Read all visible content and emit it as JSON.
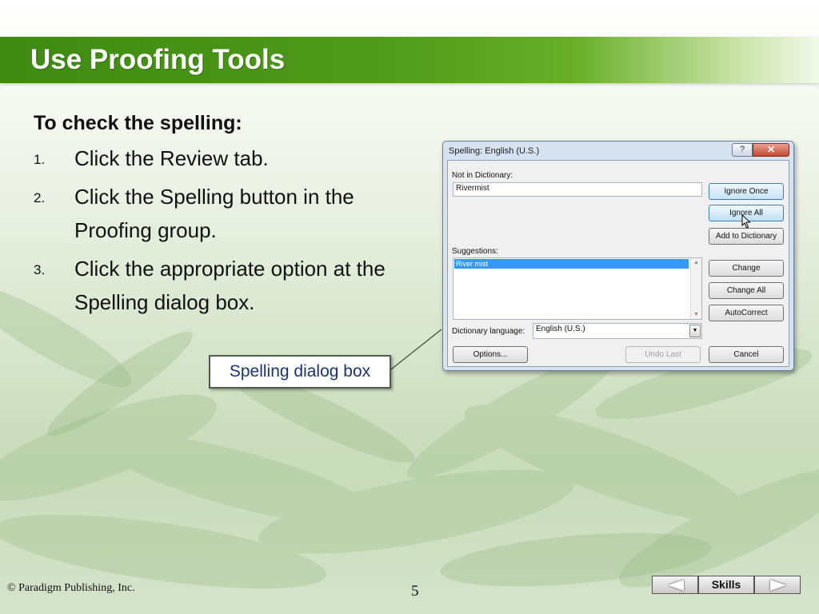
{
  "slide": {
    "title": "Use Proofing Tools",
    "heading": "To check the spelling:",
    "steps": [
      {
        "num": "1.",
        "text": "Click the Review tab."
      },
      {
        "num": "2.",
        "text": "Click the Spelling button in the Proofing group."
      },
      {
        "num": "3.",
        "text": "Click the appropriate option at the Spelling dialog box."
      }
    ],
    "callout": "Spelling dialog box"
  },
  "dialog": {
    "title": "Spelling: English (U.S.)",
    "help_glyph": "?",
    "close_glyph": "✕",
    "not_in_dictionary_label": "Not in Dictionary:",
    "not_in_dictionary_value": "Rivermist",
    "suggestions_label": "Suggestions:",
    "suggestions": [
      "River mist"
    ],
    "dictionary_language_label": "Dictionary language:",
    "dictionary_language_value": "English (U.S.)",
    "buttons": {
      "ignore_once": "Ignore Once",
      "ignore_all": "Ignore All",
      "add_to_dictionary": "Add to Dictionary",
      "change": "Change",
      "change_all": "Change All",
      "autocorrect": "AutoCorrect",
      "options": "Options...",
      "undo_last": "Undo Last",
      "cancel": "Cancel"
    }
  },
  "footer": {
    "copyright": "© Paradigm Publishing, Inc.",
    "page_number": "5",
    "nav_label": "Skills"
  },
  "colors": {
    "title_bar": "#4f9a1a",
    "callout_text": "#1a3470",
    "selection": "#3399ff"
  }
}
